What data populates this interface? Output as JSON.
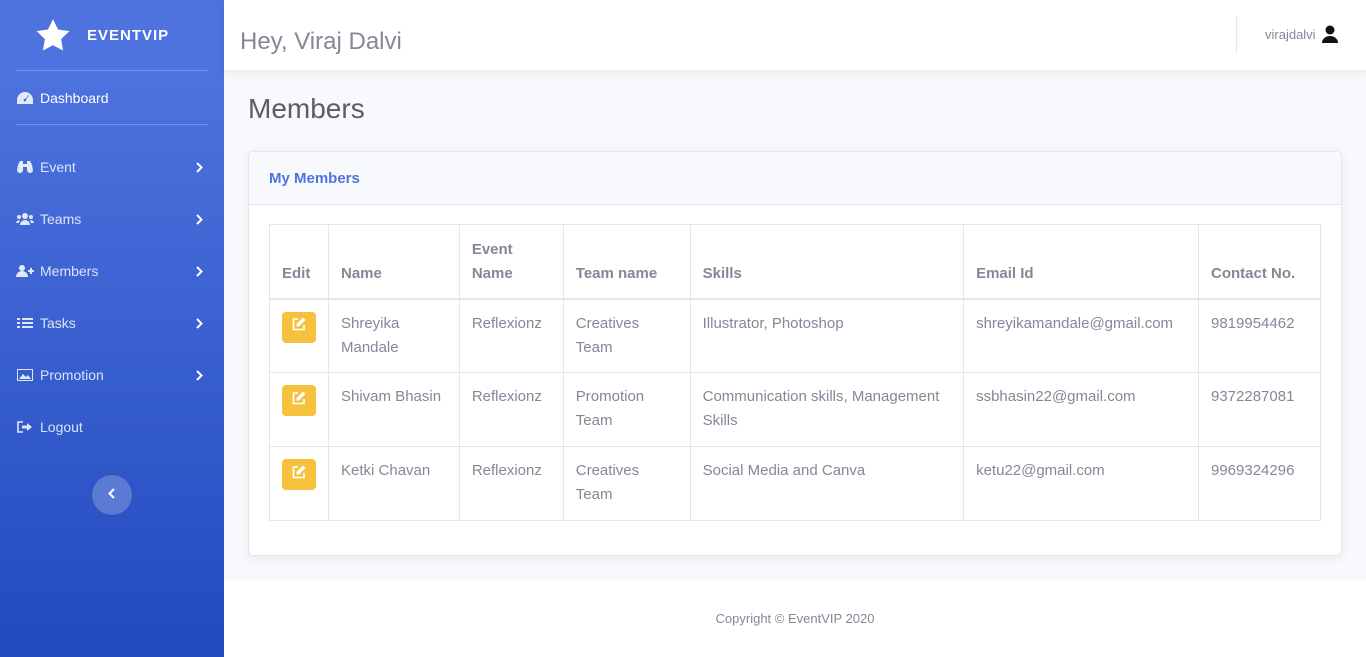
{
  "brand": {
    "name": "EVENTVIP",
    "icon": "star-icon"
  },
  "sidebar": {
    "dashboard": {
      "label": "Dashboard",
      "icon": "tachometer-icon"
    },
    "items": [
      {
        "label": "Event",
        "icon": "binoculars-icon"
      },
      {
        "label": "Teams",
        "icon": "users-icon"
      },
      {
        "label": "Members",
        "icon": "user-plus-icon"
      },
      {
        "label": "Tasks",
        "icon": "tasks-icon"
      },
      {
        "label": "Promotion",
        "icon": "image-icon"
      }
    ],
    "logout": {
      "label": "Logout",
      "icon": "sign-out-icon"
    }
  },
  "topbar": {
    "greeting": "Hey, Viraj Dalvi",
    "username": "virajdalvi"
  },
  "page": {
    "title": "Members"
  },
  "card": {
    "title": "My Members"
  },
  "table": {
    "headers": [
      "Edit",
      "Name",
      "Event Name",
      "Team name",
      "Skills",
      "Email Id",
      "Contact No."
    ],
    "rows": [
      {
        "name": "Shreyika Mandale",
        "event": "Reflexionz",
        "team": "Creatives Team",
        "skills": "Illustrator, Photoshop",
        "email": "shreyikamandale@gmail.com",
        "contact": "9819954462"
      },
      {
        "name": "Shivam Bhasin",
        "event": "Reflexionz",
        "team": "Promotion Team",
        "skills": "Communication skills, Management Skills",
        "email": "ssbhasin22@gmail.com",
        "contact": "9372287081"
      },
      {
        "name": "Ketki Chavan",
        "event": "Reflexionz",
        "team": "Creatives Team",
        "skills": "Social Media and Canva",
        "email": "ketu22@gmail.com",
        "contact": "9969324296"
      }
    ]
  },
  "footer": {
    "copyright": "Copyright © EventVIP 2020"
  },
  "colors": {
    "primary": "#4e73df",
    "warning": "#f6c23e",
    "text": "#858796"
  }
}
